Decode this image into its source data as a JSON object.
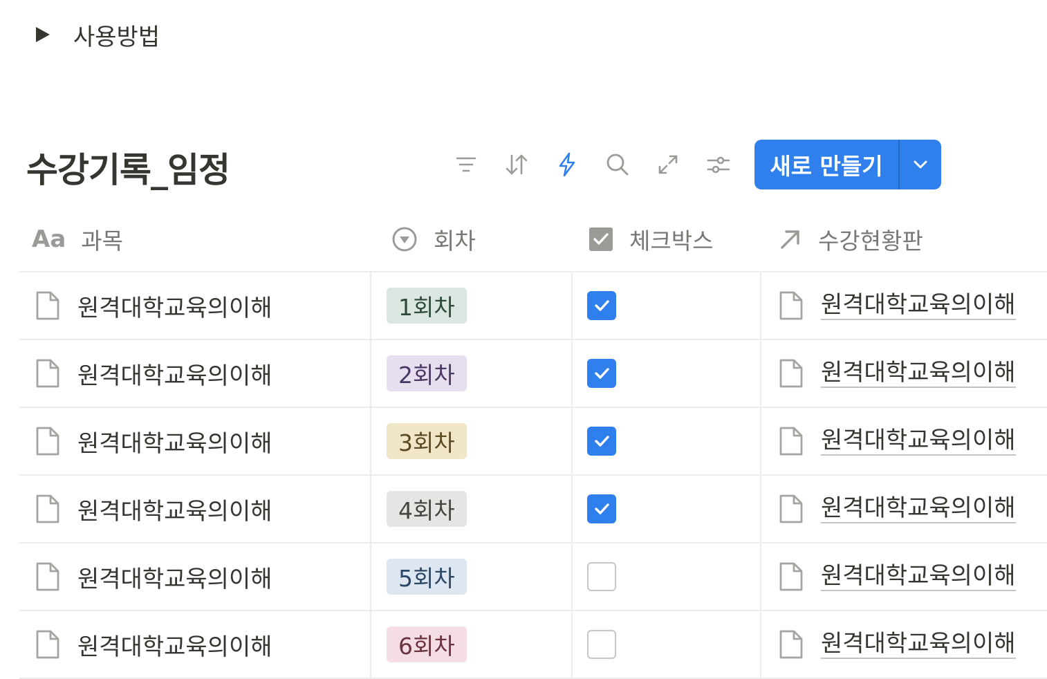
{
  "toggle": {
    "label": "사용방법",
    "icon": "triangle-right-icon"
  },
  "database": {
    "title": "수강기록_임정"
  },
  "toolbar": {
    "tools": [
      {
        "name": "filter-icon"
      },
      {
        "name": "sort-icon"
      },
      {
        "name": "automation-lightning-icon",
        "color": "#2f80ed"
      },
      {
        "name": "search-icon"
      },
      {
        "name": "expand-icon"
      },
      {
        "name": "settings-sliders-icon"
      }
    ],
    "new_button_label": "새로 만들기",
    "new_button_color": "#2f80ed"
  },
  "columns": [
    {
      "label": "과목",
      "icon": "Aa",
      "icon_name": "text-property-icon"
    },
    {
      "label": "회차",
      "icon_name": "select-property-icon"
    },
    {
      "label": "체크박스",
      "icon_name": "checkbox-property-icon"
    },
    {
      "label": "수강현황판",
      "icon_name": "relation-arrow-icon"
    }
  ],
  "rows": [
    {
      "name": "원격대학교육의이해",
      "session": "1회차",
      "tag_bg": "#dbe6e0",
      "tag_fg": "#2e4a3b",
      "checked": true,
      "relation": "원격대학교육의이해"
    },
    {
      "name": "원격대학교육의이해",
      "session": "2회차",
      "tag_bg": "#e6dff0",
      "tag_fg": "#4a3763",
      "checked": true,
      "relation": "원격대학교육의이해"
    },
    {
      "name": "원격대학교육의이해",
      "session": "3회차",
      "tag_bg": "#f1e6c8",
      "tag_fg": "#5c4a22",
      "checked": true,
      "relation": "원격대학교육의이해"
    },
    {
      "name": "원격대학교육의이해",
      "session": "4회차",
      "tag_bg": "#e6e5e3",
      "tag_fg": "#47453f",
      "checked": true,
      "relation": "원격대학교육의이해"
    },
    {
      "name": "원격대학교육의이해",
      "session": "5회차",
      "tag_bg": "#dde6f1",
      "tag_fg": "#2c4666",
      "checked": false,
      "relation": "원격대학교육의이해"
    },
    {
      "name": "원격대학교육의이해",
      "session": "6회차",
      "tag_bg": "#f4dde3",
      "tag_fg": "#6a3140",
      "checked": false,
      "relation": "원격대학교육의이해"
    }
  ]
}
